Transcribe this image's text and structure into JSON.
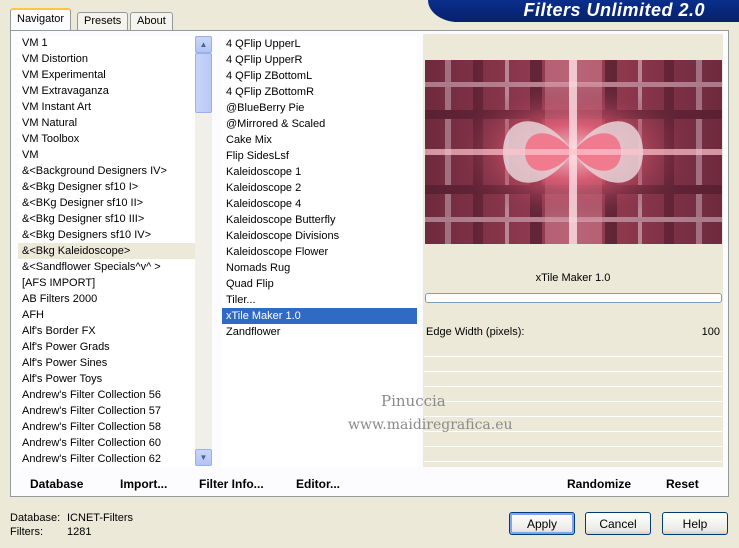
{
  "banner": {
    "title": "Filters Unlimited 2.0"
  },
  "tabs": [
    {
      "label": "Navigator"
    },
    {
      "label": "Presets"
    },
    {
      "label": "About"
    }
  ],
  "categories": [
    {
      "label": "VM 1"
    },
    {
      "label": "VM Distortion"
    },
    {
      "label": "VM Experimental"
    },
    {
      "label": "VM Extravaganza"
    },
    {
      "label": "VM Instant Art"
    },
    {
      "label": "VM Natural"
    },
    {
      "label": "VM Toolbox"
    },
    {
      "label": "VM"
    },
    {
      "label": "&<Background Designers IV>"
    },
    {
      "label": "&<Bkg Designer sf10 I>"
    },
    {
      "label": "&<BKg Designer sf10 II>"
    },
    {
      "label": "&<Bkg Designer sf10 III>"
    },
    {
      "label": "&<Bkg Designers sf10 IV>"
    },
    {
      "label": "&<Bkg Kaleidoscope>"
    },
    {
      "label": "&<Sandflower Specials^v^ >"
    },
    {
      "label": "[AFS IMPORT]"
    },
    {
      "label": "AB Filters 2000"
    },
    {
      "label": "AFH"
    },
    {
      "label": "Alf's Border FX"
    },
    {
      "label": "Alf's Power Grads"
    },
    {
      "label": "Alf's Power Sines"
    },
    {
      "label": "Alf's Power Toys"
    },
    {
      "label": "Andrew's Filter Collection 56"
    },
    {
      "label": "Andrew's Filter Collection 57"
    },
    {
      "label": "Andrew's Filter Collection 58"
    },
    {
      "label": "Andrew's Filter Collection 60"
    },
    {
      "label": "Andrew's Filter Collection 62"
    }
  ],
  "filters": [
    {
      "label": "4 QFlip UpperL"
    },
    {
      "label": "4 QFlip UpperR"
    },
    {
      "label": "4 QFlip ZBottomL"
    },
    {
      "label": "4 QFlip ZBottomR"
    },
    {
      "label": "@BlueBerry Pie"
    },
    {
      "label": "@Mirrored & Scaled"
    },
    {
      "label": "Cake Mix"
    },
    {
      "label": "Flip SidesLsf"
    },
    {
      "label": "Kaleidoscope 1"
    },
    {
      "label": "Kaleidoscope 2"
    },
    {
      "label": "Kaleidoscope 4"
    },
    {
      "label": "Kaleidoscope Butterfly"
    },
    {
      "label": "Kaleidoscope Divisions"
    },
    {
      "label": "Kaleidoscope Flower"
    },
    {
      "label": "Nomads Rug"
    },
    {
      "label": "Quad Flip"
    },
    {
      "label": "Tiler..."
    },
    {
      "label": "xTile Maker 1.0"
    },
    {
      "label": "Zandflower"
    }
  ],
  "selected_filter_title": "xTile Maker 1.0",
  "param": {
    "label": "Edge Width (pixels):",
    "value": "100"
  },
  "watermark": {
    "line1": "Pinuccia",
    "line2": "www.maidiregrafica.eu"
  },
  "bottom_links": {
    "database": "Database",
    "import": "Import...",
    "filter_info": "Filter Info...",
    "editor": "Editor...",
    "randomize": "Randomize",
    "reset": "Reset"
  },
  "status": {
    "database_label": "Database:",
    "database_value": "ICNET-Filters",
    "filters_label": "Filters:",
    "filters_value": "1281"
  },
  "buttons": {
    "apply": "Apply",
    "cancel": "Cancel",
    "help": "Help"
  },
  "colors": {
    "selection": "#316AC5",
    "banner": "#0A2F8C",
    "dialog": "#ECE9D8"
  }
}
